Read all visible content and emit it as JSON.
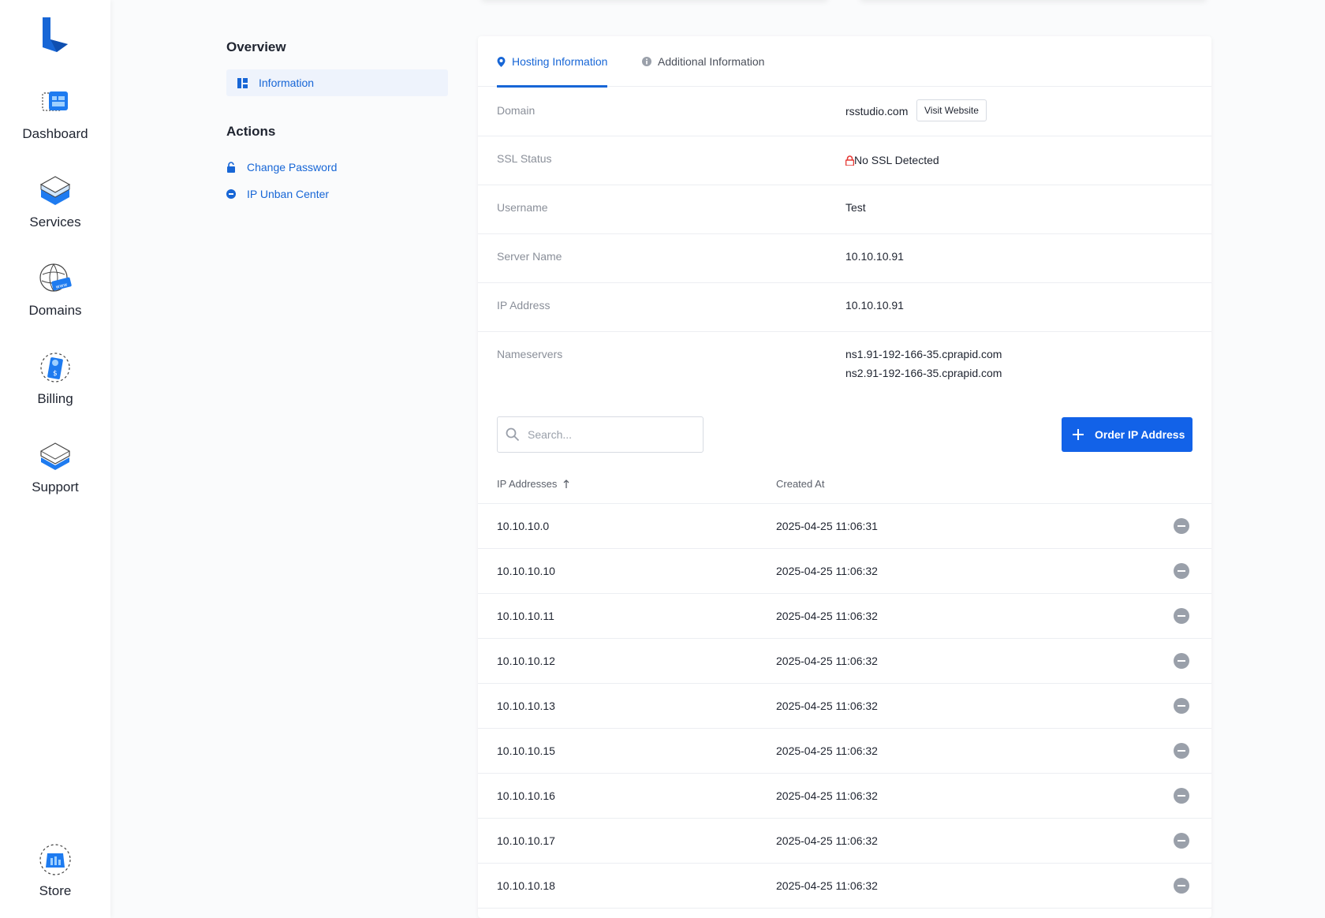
{
  "sidebar": {
    "items": [
      {
        "label": "Dashboard",
        "icon": "dashboard-icon"
      },
      {
        "label": "Services",
        "icon": "services-icon"
      },
      {
        "label": "Domains",
        "icon": "domains-icon"
      },
      {
        "label": "Billing",
        "icon": "billing-icon"
      },
      {
        "label": "Support",
        "icon": "support-icon"
      }
    ],
    "store": {
      "label": "Store",
      "icon": "store-icon"
    }
  },
  "submenu": {
    "overview_title": "Overview",
    "information_label": "Information",
    "actions_title": "Actions",
    "actions": [
      {
        "label": "Change Password",
        "icon": "lock-icon"
      },
      {
        "label": "IP Unban Center",
        "icon": "minus-circle-icon"
      }
    ]
  },
  "tabs": [
    {
      "label": "Hosting Information",
      "active": true
    },
    {
      "label": "Additional Information",
      "active": false
    }
  ],
  "hosting": {
    "domain_label": "Domain",
    "domain_value": "rsstudio.com",
    "visit_website": "Visit Website",
    "ssl_label": "SSL Status",
    "ssl_value": "No SSL Detected",
    "username_label": "Username",
    "username_value": "Test",
    "server_label": "Server Name",
    "server_value": "10.10.10.91",
    "ip_label": "IP Address",
    "ip_value": "10.10.10.91",
    "ns_label": "Nameservers",
    "ns1": "ns1.91-192-166-35.cprapid.com",
    "ns2": "ns2.91-192-166-35.cprapid.com"
  },
  "ip_table": {
    "search_placeholder": "Search...",
    "order_button": "Order IP Address",
    "col_ip": "IP Addresses",
    "col_created": "Created At",
    "rows": [
      {
        "ip": "10.10.10.0",
        "created": "2025-04-25 11:06:31"
      },
      {
        "ip": "10.10.10.10",
        "created": "2025-04-25 11:06:32"
      },
      {
        "ip": "10.10.10.11",
        "created": "2025-04-25 11:06:32"
      },
      {
        "ip": "10.10.10.12",
        "created": "2025-04-25 11:06:32"
      },
      {
        "ip": "10.10.10.13",
        "created": "2025-04-25 11:06:32"
      },
      {
        "ip": "10.10.10.15",
        "created": "2025-04-25 11:06:32"
      },
      {
        "ip": "10.10.10.16",
        "created": "2025-04-25 11:06:32"
      },
      {
        "ip": "10.10.10.17",
        "created": "2025-04-25 11:06:32"
      },
      {
        "ip": "10.10.10.18",
        "created": "2025-04-25 11:06:32"
      }
    ]
  },
  "colors": {
    "accent": "#1766d6",
    "button": "#1262e8",
    "ssl_warning": "#e53935"
  }
}
